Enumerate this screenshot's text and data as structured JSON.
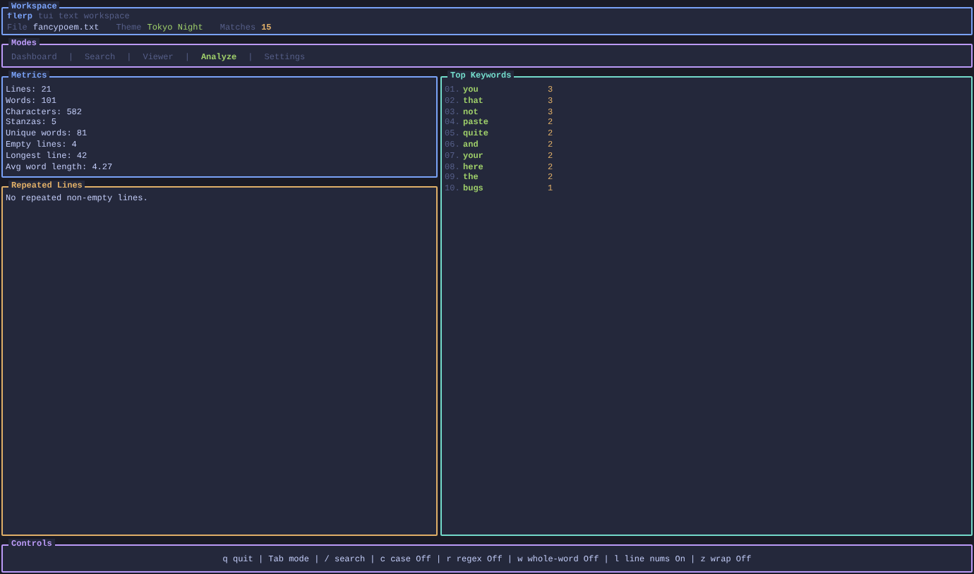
{
  "workspace": {
    "title": "Workspace",
    "app": "flerp",
    "subtitle": "tui text workspace",
    "file_label": "File",
    "file": "fancypoem.txt",
    "theme_label": "Theme",
    "theme": "Tokyo Night",
    "matches_label": "Matches",
    "matches": "15"
  },
  "modes": {
    "title": "Modes",
    "separator": "|",
    "tabs": [
      {
        "label": "Dashboard",
        "selected": false
      },
      {
        "label": "Search",
        "selected": false
      },
      {
        "label": "Viewer",
        "selected": false
      },
      {
        "label": "Analyze",
        "selected": true
      },
      {
        "label": "Settings",
        "selected": false
      }
    ]
  },
  "metrics": {
    "title": "Metrics",
    "lines": [
      "Lines: 21",
      "Words: 101",
      "Characters: 582",
      "Stanzas: 5",
      "Unique words: 81",
      "Empty lines: 4",
      "Longest line: 42",
      "Avg word length: 4.27"
    ]
  },
  "repeated_lines": {
    "title": "Repeated Lines",
    "message": "No repeated non-empty lines."
  },
  "top_keywords": {
    "title": "Top Keywords",
    "rows": [
      {
        "rank": "01.",
        "word": "you",
        "count": "3"
      },
      {
        "rank": "02.",
        "word": "that",
        "count": "3"
      },
      {
        "rank": "03.",
        "word": "not",
        "count": "3"
      },
      {
        "rank": "04.",
        "word": "paste",
        "count": "2"
      },
      {
        "rank": "05.",
        "word": "quite",
        "count": "2"
      },
      {
        "rank": "06.",
        "word": "and",
        "count": "2"
      },
      {
        "rank": "07.",
        "word": "your",
        "count": "2"
      },
      {
        "rank": "08.",
        "word": "here",
        "count": "2"
      },
      {
        "rank": "09.",
        "word": "the",
        "count": "2"
      },
      {
        "rank": "10.",
        "word": "bugs",
        "count": "1"
      }
    ]
  },
  "controls": {
    "title": "Controls",
    "text": "q quit | Tab mode | / search | c case Off | r regex Off | w whole-word Off | l line nums On | z wrap Off"
  }
}
